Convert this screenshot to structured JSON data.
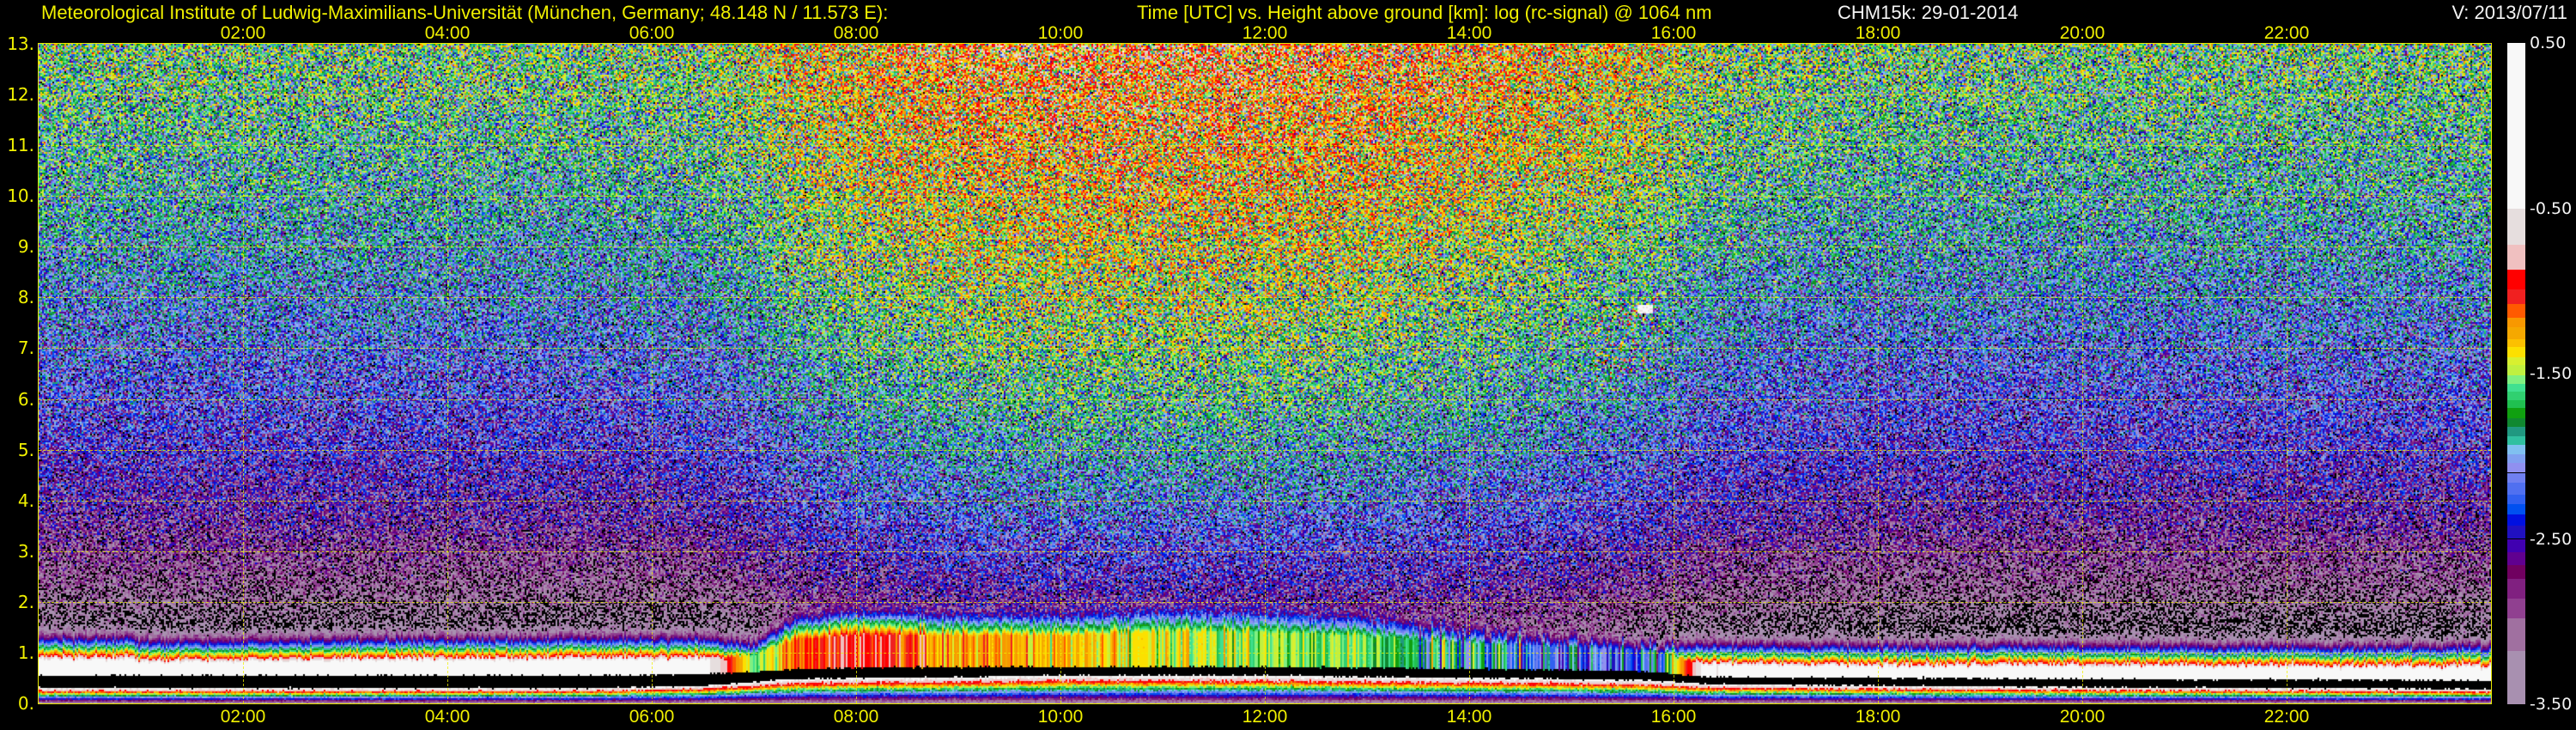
{
  "header": {
    "institute": "Meteorological Institute of Ludwig-Maximilians-Universität (München, Germany; 48.148 N / 11.573 E):",
    "description": "Time [UTC] vs. Height above ground [km]: log (rc-signal) @ 1064 nm",
    "instrument_date": "CHM15k: 29-01-2014",
    "version": "V: 2013/07/11"
  },
  "colors": {
    "axis_text": "#f0f000",
    "info_text": "#f4f4f4",
    "grid": "#f0f000",
    "background": "#000000"
  },
  "chart_data": {
    "type": "heatmap",
    "title": "Time [UTC] vs. Height above ground [km]: log (rc-signal) @ 1064 nm",
    "xlabel": "Time [UTC]",
    "ylabel": "Height above ground [km]",
    "x_range": [
      0,
      24
    ],
    "y_range": [
      0,
      13
    ],
    "grid": true,
    "x_tick_hours": [
      2,
      4,
      6,
      8,
      10,
      12,
      14,
      16,
      18,
      20,
      22
    ],
    "x_tick_labels": [
      "02:00",
      "04:00",
      "06:00",
      "08:00",
      "10:00",
      "12:00",
      "14:00",
      "16:00",
      "18:00",
      "20:00",
      "22:00"
    ],
    "y_tick_values": [
      0,
      1,
      2,
      3,
      4,
      5,
      6,
      7,
      8,
      9,
      10,
      11,
      12,
      13
    ],
    "y_tick_labels": [
      "0.",
      "1.",
      "2.",
      "3.",
      "4.",
      "5.",
      "6.",
      "7.",
      "8.",
      "9.",
      "10.",
      "11.",
      "12.",
      "13."
    ],
    "colorbar": {
      "label": "log (rc-signal)",
      "range": [
        -3.5,
        0.5
      ],
      "tick_values": [
        0.5,
        -0.5,
        -1.5,
        -2.5,
        -3.5
      ],
      "tick_labels": [
        "0.50",
        "-0.50",
        "-1.50",
        "-2.50",
        "-3.50"
      ],
      "levels": [
        [
          -0.5,
          "#f8f8f8"
        ],
        [
          -0.72,
          "#e6dede"
        ],
        [
          -0.87,
          "#f0c0c0"
        ],
        [
          -0.99,
          "#ff0000"
        ],
        [
          -1.08,
          "#f02020"
        ],
        [
          -1.16,
          "#ff5a00"
        ],
        [
          -1.22,
          "#f89800"
        ],
        [
          -1.29,
          "#f5a800"
        ],
        [
          -1.34,
          "#fcc000"
        ],
        [
          -1.4,
          "#fce000"
        ],
        [
          -1.45,
          "#d8f030"
        ],
        [
          -1.51,
          "#c0f040"
        ],
        [
          -1.56,
          "#80f080"
        ],
        [
          -1.61,
          "#40e090"
        ],
        [
          -1.66,
          "#30d070"
        ],
        [
          -1.71,
          "#20c050"
        ],
        [
          -1.77,
          "#10a010"
        ],
        [
          -1.82,
          "#108830"
        ],
        [
          -1.88,
          "#209880"
        ],
        [
          -1.93,
          "#30c0a0"
        ],
        [
          -1.99,
          "#80c0f0"
        ],
        [
          -2.04,
          "#80a0f0"
        ],
        [
          -2.1,
          "#9090f0"
        ],
        [
          -2.16,
          "#7080f0"
        ],
        [
          -2.23,
          "#5070f0"
        ],
        [
          -2.29,
          "#3060f0"
        ],
        [
          -2.35,
          "#0050f0"
        ],
        [
          -2.42,
          "#0010e0"
        ],
        [
          -2.5,
          "#2010c0"
        ],
        [
          -2.58,
          "#4000b0"
        ],
        [
          -2.66,
          "#600090"
        ],
        [
          -2.74,
          "#700060"
        ],
        [
          -2.86,
          "#802080"
        ],
        [
          -2.98,
          "#904090"
        ],
        [
          -3.18,
          "#a070a0"
        ],
        [
          -3.5,
          "#a890b0"
        ]
      ]
    },
    "layer_structure": {
      "hours": [
        0,
        0.9,
        1.0,
        5.5,
        6.5,
        7.0,
        7.4,
        8.0,
        9.0,
        10.0,
        11.0,
        12.0,
        13.0,
        14.0,
        15.0,
        15.8,
        16.3,
        18,
        20,
        22,
        24
      ],
      "overlap_gap_bottom_km": [
        0.3,
        0.3,
        0.3,
        0.3,
        0.35,
        0.42,
        0.48,
        0.5,
        0.52,
        0.55,
        0.55,
        0.55,
        0.52,
        0.5,
        0.48,
        0.45,
        0.38,
        0.35,
        0.32,
        0.3,
        0.28
      ],
      "overlap_gap_top_km": [
        0.55,
        0.55,
        0.55,
        0.55,
        0.58,
        0.62,
        0.68,
        0.7,
        0.72,
        0.72,
        0.72,
        0.72,
        0.7,
        0.68,
        0.66,
        0.62,
        0.52,
        0.5,
        0.48,
        0.47,
        0.45
      ],
      "layer_top_km": [
        0.95,
        0.95,
        0.9,
        0.95,
        0.95,
        1.1,
        1.5,
        1.6,
        1.6,
        1.6,
        1.7,
        1.7,
        1.6,
        1.4,
        1.3,
        1.2,
        0.85,
        0.8,
        0.8,
        0.78,
        0.78
      ],
      "layer_log_signal": [
        -0.2,
        -0.2,
        -0.3,
        -0.2,
        -0.3,
        -1.6,
        -1.1,
        -0.95,
        -1.2,
        -1.3,
        -1.45,
        -1.5,
        -1.6,
        -1.9,
        -2.2,
        -2.3,
        -0.4,
        -0.2,
        -0.2,
        -0.2,
        -0.2
      ],
      "background_log_noise": [
        -3.75,
        -3.75,
        -3.75,
        -3.75,
        -3.7,
        -3.6,
        -3.45,
        -3.35,
        -3.25,
        -3.2,
        -3.2,
        -3.2,
        -3.25,
        -3.3,
        -3.4,
        -3.5,
        -3.65,
        -3.75,
        -3.75,
        -3.75,
        -3.75
      ]
    },
    "cirrus_feature": {
      "time_hours": [
        15.2,
        15.9
      ],
      "height_km": [
        6.3,
        8.0
      ]
    }
  }
}
